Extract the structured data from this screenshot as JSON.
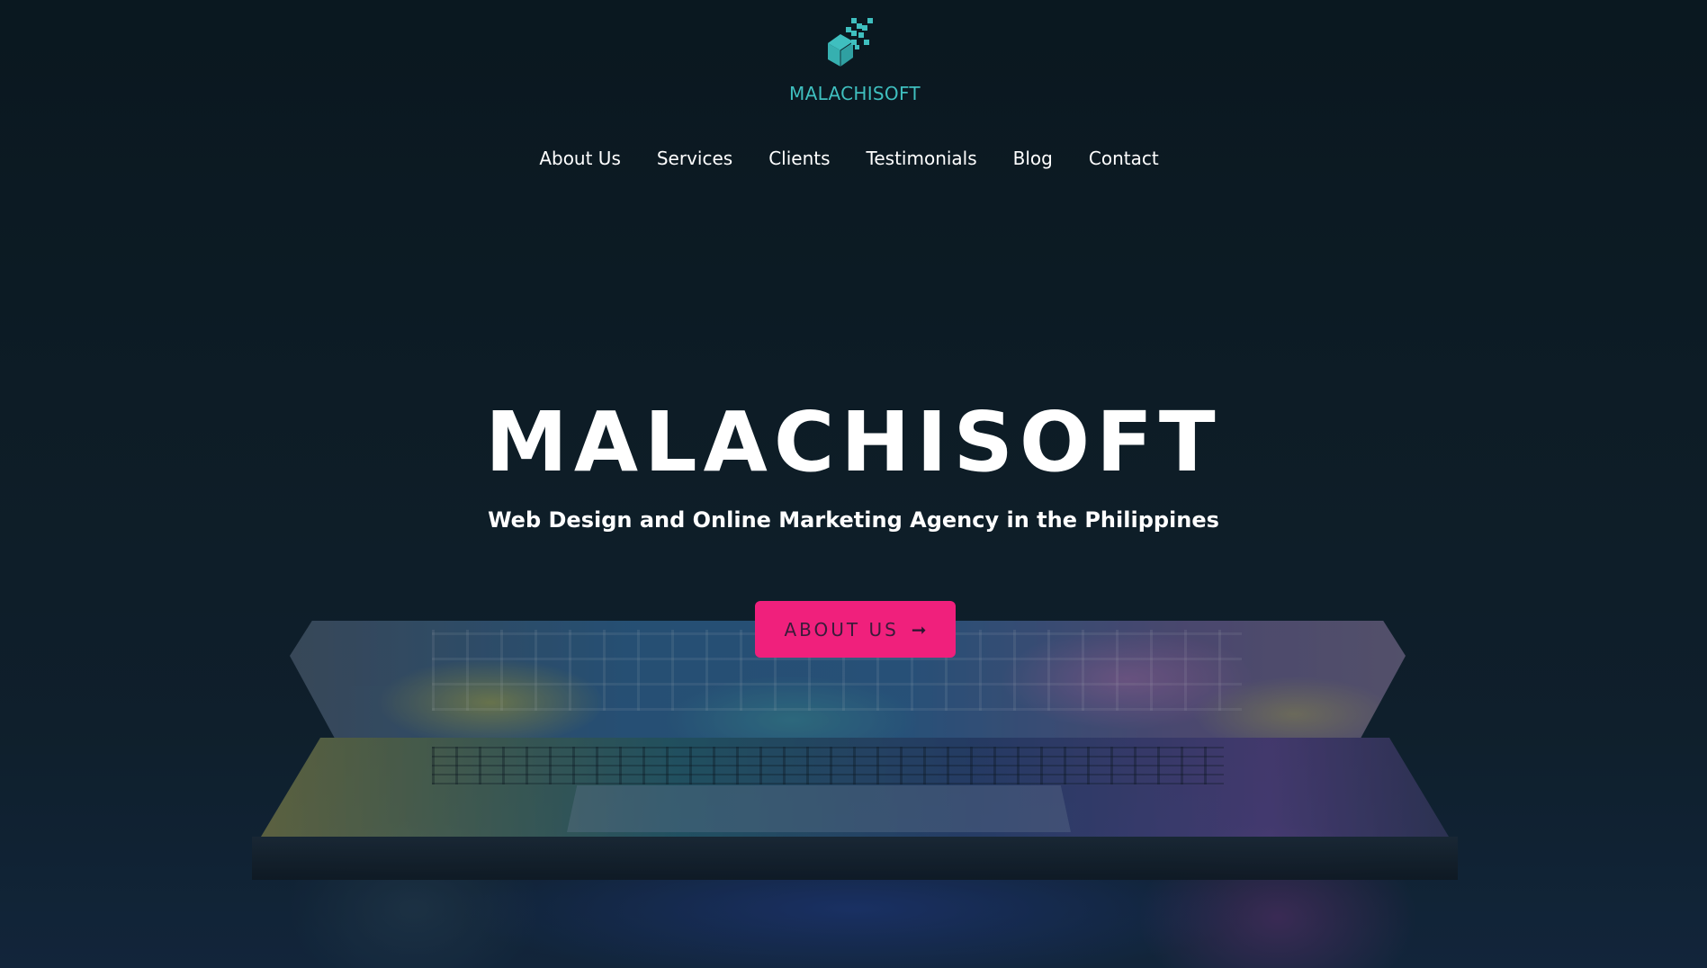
{
  "brand": {
    "logo_text": "MALACHISOFT",
    "logo_icon": "pixel-cube-icon",
    "accent_color": "#3fbfbf"
  },
  "nav": {
    "items": [
      {
        "label": "About Us"
      },
      {
        "label": "Services"
      },
      {
        "label": "Clients"
      },
      {
        "label": "Testimonials"
      },
      {
        "label": "Blog"
      },
      {
        "label": "Contact"
      }
    ]
  },
  "hero": {
    "title": "MALACHISOFT",
    "subtitle": "Web Design and Online Marketing Agency in the Philippines",
    "cta_label": "ABOUT US",
    "cta_icon": "arrow-right-icon",
    "cta_arrow": "➞",
    "cta_color": "#f0207c",
    "background_image": "laptop-keyboard-photo"
  }
}
